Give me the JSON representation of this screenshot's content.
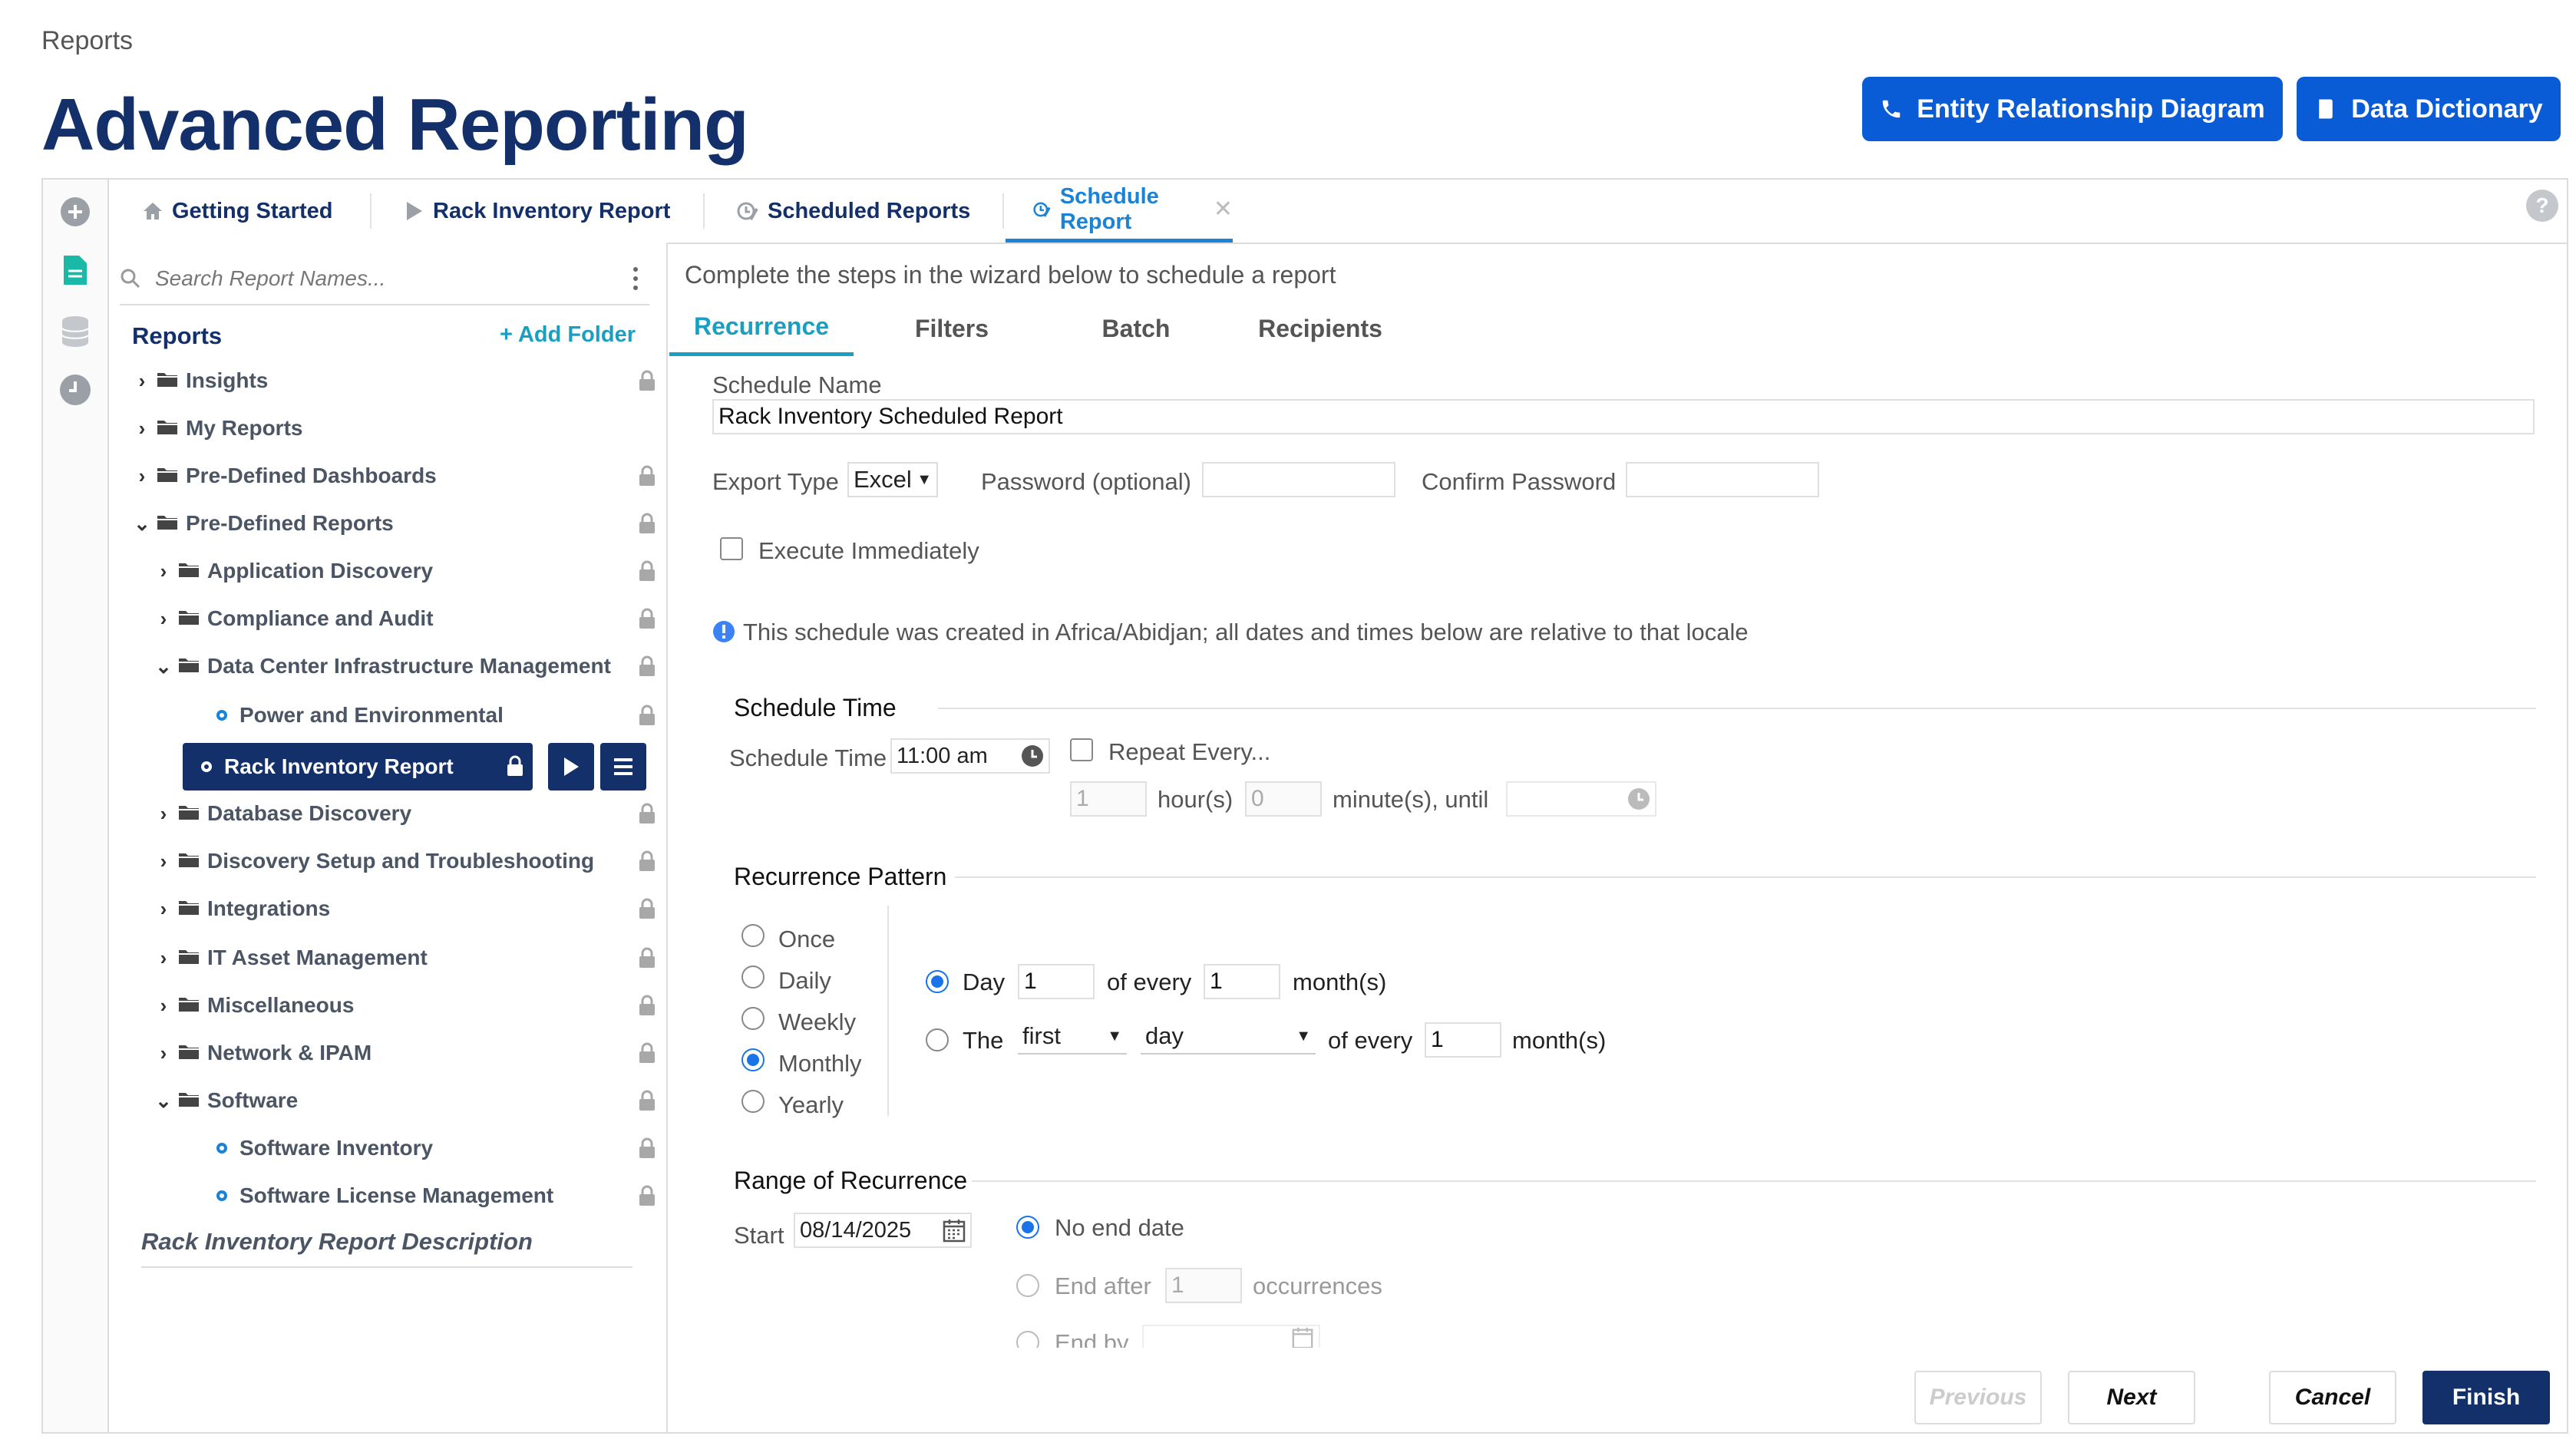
{
  "breadcrumb": "Reports",
  "page_title": "Advanced Reporting",
  "header_buttons": {
    "erd": "Entity Relationship Diagram",
    "dictionary": "Data Dictionary"
  },
  "tabs": [
    {
      "label": "Getting Started",
      "icon": "home-icon"
    },
    {
      "label": "Rack Inventory Report",
      "icon": "play-icon"
    },
    {
      "label": "Scheduled Reports",
      "icon": "clock-edit-icon"
    },
    {
      "label": "Schedule Report",
      "icon": "clock-edit-icon",
      "active": true
    }
  ],
  "sidebar": {
    "search_placeholder": "Search Report Names...",
    "tree_title": "Reports",
    "add_folder": "+ Add Folder",
    "items": [
      {
        "label": "Insights",
        "level": 0,
        "type": "folder",
        "expanded": false,
        "locked": true
      },
      {
        "label": "My Reports",
        "level": 0,
        "type": "folder",
        "expanded": false,
        "locked": false
      },
      {
        "label": "Pre-Defined Dashboards",
        "level": 0,
        "type": "folder",
        "expanded": false,
        "locked": true
      },
      {
        "label": "Pre-Defined Reports",
        "level": 0,
        "type": "folder",
        "expanded": true,
        "locked": true
      },
      {
        "label": "Application Discovery",
        "level": 1,
        "type": "folder",
        "expanded": false,
        "locked": true
      },
      {
        "label": "Compliance and Audit",
        "level": 1,
        "type": "folder",
        "expanded": false,
        "locked": true
      },
      {
        "label": "Data Center Infrastructure Management",
        "level": 1,
        "type": "folder",
        "expanded": true,
        "locked": true
      },
      {
        "label": "Power and Environmental",
        "level": 2,
        "type": "report",
        "locked": true
      },
      {
        "label": "Rack Inventory Report",
        "level": 2,
        "type": "report",
        "locked": true,
        "selected": true
      },
      {
        "label": "Database Discovery",
        "level": 1,
        "type": "folder",
        "expanded": false,
        "locked": true
      },
      {
        "label": "Discovery Setup and Troubleshooting",
        "level": 1,
        "type": "folder",
        "expanded": false,
        "locked": true
      },
      {
        "label": "Integrations",
        "level": 1,
        "type": "folder",
        "expanded": false,
        "locked": true
      },
      {
        "label": "IT Asset Management",
        "level": 1,
        "type": "folder",
        "expanded": false,
        "locked": true
      },
      {
        "label": "Miscellaneous",
        "level": 1,
        "type": "folder",
        "expanded": false,
        "locked": true
      },
      {
        "label": "Network & IPAM",
        "level": 1,
        "type": "folder",
        "expanded": false,
        "locked": true
      },
      {
        "label": "Software",
        "level": 1,
        "type": "folder",
        "expanded": true,
        "locked": true
      },
      {
        "label": "Software Inventory",
        "level": 2,
        "type": "report",
        "locked": true
      },
      {
        "label": "Software License Management",
        "level": 2,
        "type": "report",
        "locked": true
      }
    ],
    "description_title": "Rack Inventory Report Description"
  },
  "wizard": {
    "intro": "Complete the steps in the wizard below to schedule a report",
    "tabs": [
      "Recurrence",
      "Filters",
      "Batch",
      "Recipients"
    ],
    "schedule_name_label": "Schedule Name",
    "schedule_name_value": "Rack Inventory Scheduled Report",
    "export_type_label": "Export Type",
    "export_type_value": "Excel",
    "password_label": "Password (optional)",
    "confirm_password_label": "Confirm Password",
    "execute_immediately": "Execute Immediately",
    "locale_note": "This schedule was created in Africa/Abidjan; all dates and times below are relative to that locale",
    "schedule_time_section": "Schedule Time",
    "schedule_time_label": "Schedule Time",
    "schedule_time_value": "11:00 am",
    "repeat_every": "Repeat Every...",
    "repeat_hours": "1",
    "hours_label": "hour(s)",
    "repeat_minutes": "0",
    "minutes_until_label": "minute(s), until",
    "recurrence_section": "Recurrence Pattern",
    "patterns": [
      "Once",
      "Daily",
      "Weekly",
      "Monthly",
      "Yearly"
    ],
    "selected_pattern": "Monthly",
    "day_label": "Day",
    "day_value": "1",
    "of_every": "of every",
    "every_month_value": "1",
    "months": "month(s)",
    "the_label": "The",
    "ordinal_value": "first",
    "weekday_value": "day",
    "the_every_value": "1",
    "range_section": "Range of Recurrence",
    "start_label": "Start",
    "start_value": "08/14/2025",
    "no_end_date": "No end date",
    "end_after": "End after",
    "end_after_value": "1",
    "occurrences": "occurrences",
    "end_by": "End by"
  },
  "footer": {
    "previous": "Previous",
    "next": "Next",
    "cancel": "Cancel",
    "finish": "Finish"
  },
  "colors": {
    "navy": "#13306b",
    "blue": "#0a5bd6",
    "teal": "#1a9fc2",
    "radio": "#1a73e8"
  }
}
